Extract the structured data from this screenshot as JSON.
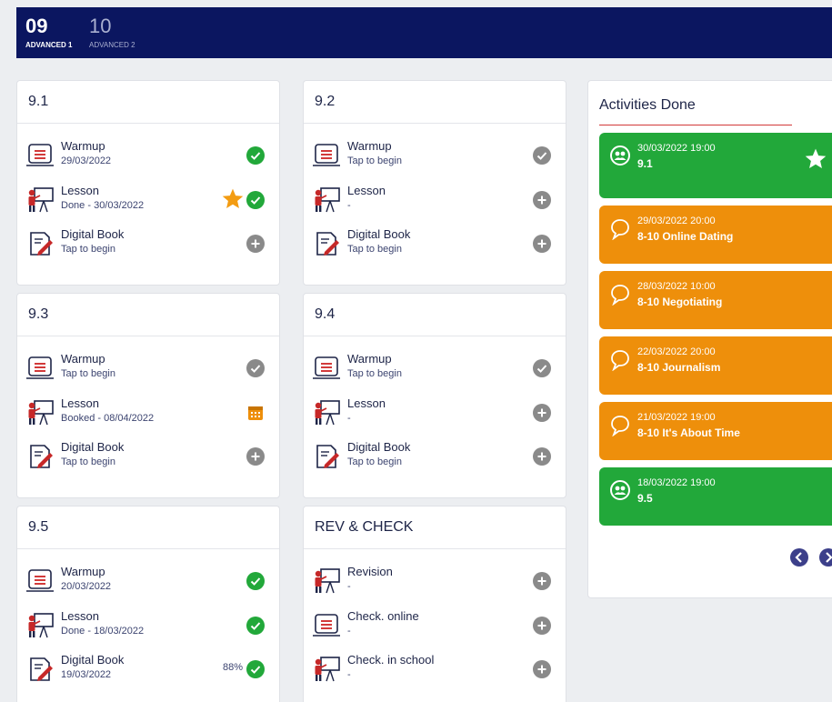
{
  "tabs": [
    {
      "number": "09",
      "label": "ADVANCED 1",
      "active": true
    },
    {
      "number": "10",
      "label": "ADVANCED 2",
      "active": false
    }
  ],
  "units": [
    {
      "title": "9.1",
      "rows": [
        {
          "icon": "warmup-icon",
          "title": "Warmup",
          "subtitle": "29/03/2022",
          "status": "done"
        },
        {
          "icon": "lesson-icon",
          "title": "Lesson",
          "subtitle": "Done - 30/03/2022",
          "status": "done-star"
        },
        {
          "icon": "digital-book-icon",
          "title": "Digital Book",
          "subtitle": "Tap to begin",
          "status": "add"
        }
      ]
    },
    {
      "title": "9.2",
      "rows": [
        {
          "icon": "warmup-icon",
          "title": "Warmup",
          "subtitle": "Tap to begin",
          "status": "pending"
        },
        {
          "icon": "lesson-icon",
          "title": "Lesson",
          "subtitle": "-",
          "status": "add"
        },
        {
          "icon": "digital-book-icon",
          "title": "Digital Book",
          "subtitle": "Tap to begin",
          "status": "add"
        }
      ]
    },
    {
      "title": "9.3",
      "rows": [
        {
          "icon": "warmup-icon",
          "title": "Warmup",
          "subtitle": "Tap to begin",
          "status": "pending"
        },
        {
          "icon": "lesson-icon",
          "title": "Lesson",
          "subtitle": "Booked - 08/04/2022",
          "status": "booked"
        },
        {
          "icon": "digital-book-icon",
          "title": "Digital Book",
          "subtitle": "Tap to begin",
          "status": "add"
        }
      ]
    },
    {
      "title": "9.4",
      "rows": [
        {
          "icon": "warmup-icon",
          "title": "Warmup",
          "subtitle": "Tap to begin",
          "status": "pending"
        },
        {
          "icon": "lesson-icon",
          "title": "Lesson",
          "subtitle": "-",
          "status": "add"
        },
        {
          "icon": "digital-book-icon",
          "title": "Digital Book",
          "subtitle": "Tap to begin",
          "status": "add"
        }
      ]
    },
    {
      "title": "9.5",
      "rows": [
        {
          "icon": "warmup-icon",
          "title": "Warmup",
          "subtitle": "20/03/2022",
          "status": "done"
        },
        {
          "icon": "lesson-icon",
          "title": "Lesson",
          "subtitle": "Done - 18/03/2022",
          "status": "done"
        },
        {
          "icon": "digital-book-icon",
          "title": "Digital Book",
          "subtitle": "19/03/2022",
          "status": "done",
          "percent": "88%"
        }
      ]
    },
    {
      "title": "REV & CHECK",
      "rows": [
        {
          "icon": "lesson-icon",
          "title": "Revision",
          "subtitle": "-",
          "status": "add"
        },
        {
          "icon": "warmup-icon",
          "title": "Check. online",
          "subtitle": "-",
          "status": "add"
        },
        {
          "icon": "lesson-icon",
          "title": "Check. in school",
          "subtitle": "-",
          "status": "add"
        }
      ]
    }
  ],
  "activities": {
    "title": "Activities Done",
    "items": [
      {
        "date": "30/03/2022 19:00",
        "name": "9.1",
        "kind": "green",
        "icon": "group-icon",
        "starred": true
      },
      {
        "date": "29/03/2022 20:00",
        "name": "8-10 Online Dating",
        "kind": "orange",
        "icon": "chat-bubble-icon",
        "starred": false
      },
      {
        "date": "28/03/2022 10:00",
        "name": "8-10 Negotiating",
        "kind": "orange",
        "icon": "chat-bubble-icon",
        "starred": false
      },
      {
        "date": "22/03/2022 20:00",
        "name": "8-10 Journalism",
        "kind": "orange",
        "icon": "chat-bubble-icon",
        "starred": false
      },
      {
        "date": "21/03/2022 19:00",
        "name": "8-10 It's About Time",
        "kind": "orange",
        "icon": "chat-bubble-icon",
        "starred": false
      },
      {
        "date": "18/03/2022 19:00",
        "name": "9.5",
        "kind": "green",
        "icon": "group-icon",
        "starred": false
      }
    ]
  },
  "colors": {
    "header": "#0b1660",
    "done": "#22a83a",
    "pending": "#8a8a8a",
    "booked": "#ee8f0b",
    "star": "#f39c12",
    "activity_green": "#22a83a",
    "activity_orange": "#ee8f0b",
    "underline": "#d23a3a"
  }
}
